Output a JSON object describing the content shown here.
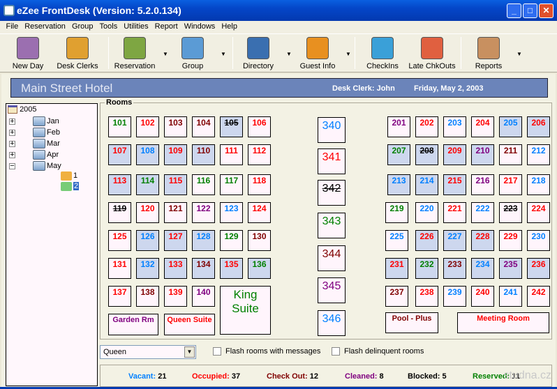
{
  "window": {
    "title": "eZee FrontDesk (Version: 5.2.0.134)",
    "minimize": "_",
    "maximize": "□",
    "close": "✕"
  },
  "menu": [
    "File",
    "Reservation",
    "Group",
    "Tools",
    "Utilities",
    "Report",
    "Windows",
    "Help"
  ],
  "toolbar": [
    {
      "label": "New Day",
      "icon": "calendar-clock-icon",
      "color": "#9b6fb0"
    },
    {
      "label": "Desk Clerks",
      "icon": "folder-clerk-icon",
      "color": "#e0a030"
    },
    {
      "label": "Reservation",
      "icon": "reservation-icon",
      "color": "#7ea642",
      "dropdown": true
    },
    {
      "label": "Group",
      "icon": "group-people-icon",
      "color": "#5b9bd5",
      "dropdown": true
    },
    {
      "label": "Directory",
      "icon": "directory-phone-icon",
      "color": "#3a6fb0",
      "dropdown": true
    },
    {
      "label": "Guest Info",
      "icon": "guest-info-icon",
      "color": "#e89020",
      "dropdown": true
    },
    {
      "label": "CheckIns",
      "icon": "checkin-icon",
      "color": "#3aa0d8"
    },
    {
      "label": "Late ChkOuts",
      "icon": "late-checkout-icon",
      "color": "#e06040"
    },
    {
      "label": "Reports",
      "icon": "reports-box-icon",
      "color": "#c89060",
      "dropdown": true
    }
  ],
  "header": {
    "hotel": "Main Street Hotel",
    "clerk": "Desk Clerk: John",
    "date": "Friday, May 2, 2003"
  },
  "tree": {
    "year": "2005",
    "months": [
      "Jan",
      "Feb",
      "Mar",
      "Apr",
      "May"
    ],
    "days": [
      "1",
      "2"
    ],
    "selected_day": "2"
  },
  "rooms_title": "Rooms",
  "colors": {
    "g": "#008000",
    "r": "#ff0000",
    "d": "#800000",
    "b": "#0080ff",
    "p": "#800080",
    "k": "#000000"
  },
  "rooms_left": [
    [
      [
        "101",
        "g",
        0
      ],
      [
        "102",
        "r",
        0
      ],
      [
        "103",
        "d",
        0
      ],
      [
        "104",
        "d",
        0
      ],
      [
        "105",
        "k",
        1
      ],
      [
        "106",
        "r",
        0
      ]
    ],
    [
      [
        "107",
        "r",
        1
      ],
      [
        "108",
        "b",
        1
      ],
      [
        "109",
        "r",
        1
      ],
      [
        "110",
        "d",
        1
      ],
      [
        "111",
        "r",
        0
      ],
      [
        "112",
        "r",
        0
      ]
    ],
    [
      [
        "113",
        "r",
        1
      ],
      [
        "114",
        "g",
        1
      ],
      [
        "115",
        "r",
        1
      ],
      [
        "116",
        "g",
        0
      ],
      [
        "117",
        "g",
        0
      ],
      [
        "118",
        "r",
        0
      ]
    ],
    [
      [
        "119",
        "k",
        0
      ],
      [
        "120",
        "r",
        0
      ],
      [
        "121",
        "d",
        0
      ],
      [
        "122",
        "p",
        0
      ],
      [
        "123",
        "b",
        0
      ],
      [
        "124",
        "r",
        0
      ]
    ],
    [
      [
        "125",
        "r",
        0
      ],
      [
        "126",
        "b",
        1
      ],
      [
        "127",
        "r",
        1
      ],
      [
        "128",
        "b",
        1
      ],
      [
        "129",
        "g",
        0
      ],
      [
        "130",
        "d",
        0
      ]
    ],
    [
      [
        "131",
        "r",
        0
      ],
      [
        "132",
        "b",
        1
      ],
      [
        "133",
        "r",
        1
      ],
      [
        "134",
        "d",
        1
      ],
      [
        "135",
        "r",
        1
      ],
      [
        "136",
        "g",
        1
      ]
    ],
    [
      [
        "137",
        "r",
        0
      ],
      [
        "138",
        "d",
        0
      ],
      [
        "139",
        "r",
        0
      ],
      [
        "140",
        "p",
        0
      ]
    ]
  ],
  "rooms_right": [
    [
      [
        "201",
        "p",
        0
      ],
      [
        "202",
        "r",
        0
      ],
      [
        "203",
        "b",
        0
      ],
      [
        "204",
        "r",
        0
      ],
      [
        "205",
        "b",
        1
      ],
      [
        "206",
        "r",
        1
      ]
    ],
    [
      [
        "207",
        "g",
        1
      ],
      [
        "208",
        "k",
        1
      ],
      [
        "209",
        "r",
        1
      ],
      [
        "210",
        "p",
        1
      ],
      [
        "211",
        "d",
        0
      ],
      [
        "212",
        "b",
        0
      ]
    ],
    [
      [
        "213",
        "b",
        1
      ],
      [
        "214",
        "b",
        1
      ],
      [
        "215",
        "r",
        1
      ],
      [
        "216",
        "p",
        0
      ],
      [
        "217",
        "r",
        0
      ],
      [
        "218",
        "b",
        0
      ]
    ],
    [
      [
        "219",
        "g",
        0
      ],
      [
        "220",
        "b",
        0
      ],
      [
        "221",
        "r",
        0
      ],
      [
        "222",
        "b",
        0
      ],
      [
        "223",
        "k",
        0
      ],
      [
        "224",
        "r",
        0
      ]
    ],
    [
      [
        "225",
        "b",
        0
      ],
      [
        "226",
        "r",
        1
      ],
      [
        "227",
        "b",
        1
      ],
      [
        "228",
        "r",
        1
      ],
      [
        "229",
        "r",
        0
      ],
      [
        "230",
        "b",
        0
      ]
    ],
    [
      [
        "231",
        "r",
        1
      ],
      [
        "232",
        "g",
        1
      ],
      [
        "233",
        "d",
        1
      ],
      [
        "234",
        "b",
        1
      ],
      [
        "235",
        "p",
        1
      ],
      [
        "236",
        "r",
        1
      ]
    ],
    [
      [
        "237",
        "d",
        0
      ],
      [
        "238",
        "r",
        0
      ],
      [
        "239",
        "b",
        0
      ],
      [
        "240",
        "r",
        0
      ],
      [
        "241",
        "b",
        0
      ],
      [
        "242",
        "r",
        0
      ]
    ]
  ],
  "rooms_middle": [
    [
      "340",
      "b"
    ],
    [
      "341",
      "r"
    ],
    [
      "342",
      "k"
    ],
    [
      "343",
      "g"
    ],
    [
      "344",
      "d"
    ],
    [
      "345",
      "p"
    ],
    [
      "346",
      "b"
    ]
  ],
  "special_rooms": [
    {
      "name": "King Suite",
      "color": "g"
    },
    {
      "name": "Garden Rm",
      "color": "p"
    },
    {
      "name": "Queen Suite",
      "color": "r"
    },
    {
      "name": "Pool - Plus",
      "color": "d"
    },
    {
      "name": "Meeting Room",
      "color": "r"
    }
  ],
  "filter": {
    "room_type": "Queen",
    "flash_messages": "Flash rooms with messages",
    "flash_delinquent": "Flash delinquent rooms"
  },
  "stats": [
    {
      "label": "Vacant:",
      "value": "21",
      "color": "b"
    },
    {
      "label": "Occupied:",
      "value": "37",
      "color": "r"
    },
    {
      "label": "Check Out:",
      "value": "12",
      "color": "d"
    },
    {
      "label": "Cleaned:",
      "value": "8",
      "color": "p"
    },
    {
      "label": "Blocked:",
      "value": "5",
      "color": "k"
    },
    {
      "label": "Reserved:",
      "value": "11",
      "color": "g"
    }
  ],
  "watermark": "studna.cz"
}
